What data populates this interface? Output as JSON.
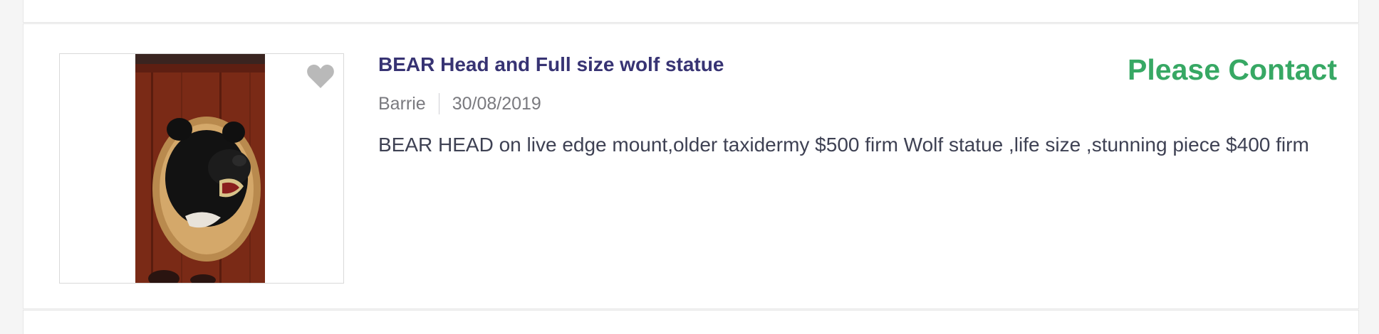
{
  "listing": {
    "title": "BEAR Head and Full size wolf statue",
    "location": "Barrie",
    "date": "30/08/2019",
    "description": "BEAR HEAD on live edge mount,older taxidermy $500 firm Wolf statue ,life size ,stunning piece $400 firm",
    "price": "Please Contact",
    "favorite_icon": "heart-icon",
    "colors": {
      "title": "#373373",
      "price": "#37a864",
      "meta": "#7a7a7f",
      "description": "#3e4153"
    }
  }
}
